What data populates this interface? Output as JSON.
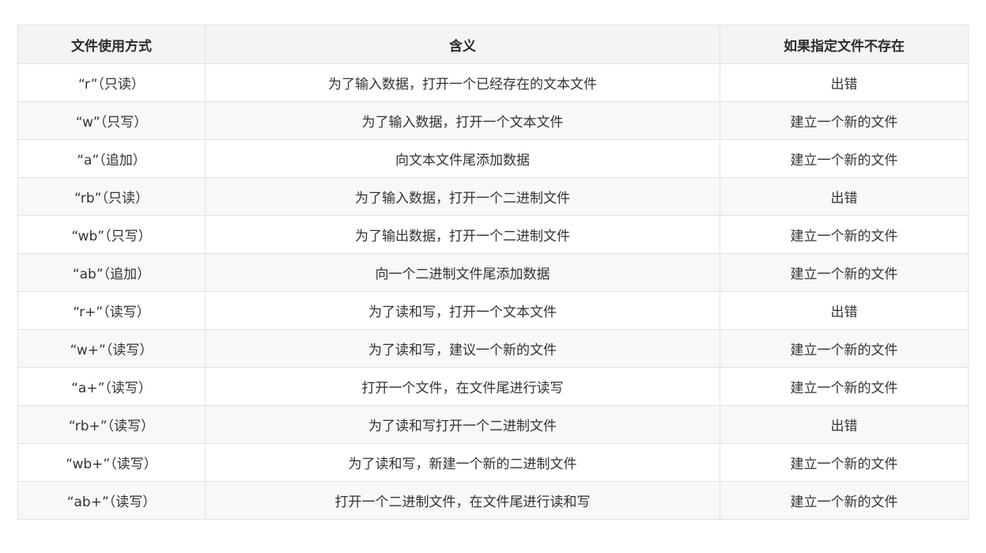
{
  "table": {
    "headers": [
      "文件使用方式",
      "含义",
      "如果指定文件不存在"
    ],
    "rows": [
      [
        "“r”（只读）",
        "为了输入数据，打开一个已经存在的文本文件",
        "出错"
      ],
      [
        "“w”（只写）",
        "为了输入数据，打开一个文本文件",
        "建立一个新的文件"
      ],
      [
        "“a”（追加）",
        "向文本文件尾添加数据",
        "建立一个新的文件"
      ],
      [
        "“rb”（只读）",
        "为了输入数据，打开一个二进制文件",
        "出错"
      ],
      [
        "“wb”（只写）",
        "为了输出数据，打开一个二进制文件",
        "建立一个新的文件"
      ],
      [
        "“ab”（追加）",
        "向一个二进制文件尾添加数据",
        "建立一个新的文件"
      ],
      [
        "“r+”（读写）",
        "为了读和写，打开一个文本文件",
        "出错"
      ],
      [
        "“w+”（读写）",
        "为了读和写，建议一个新的文件",
        "建立一个新的文件"
      ],
      [
        "“a+”（读写）",
        "打开一个文件，在文件尾进行读写",
        "建立一个新的文件"
      ],
      [
        "“rb+”（读写）",
        "为了读和写打开一个二进制文件",
        "出错"
      ],
      [
        "“wb+”（读写）",
        "为了读和写，新建一个新的二进制文件",
        "建立一个新的文件"
      ],
      [
        "“ab+”（读写）",
        "打开一个二进制文件，在文件尾进行读和写",
        "建立一个新的文件"
      ]
    ]
  }
}
